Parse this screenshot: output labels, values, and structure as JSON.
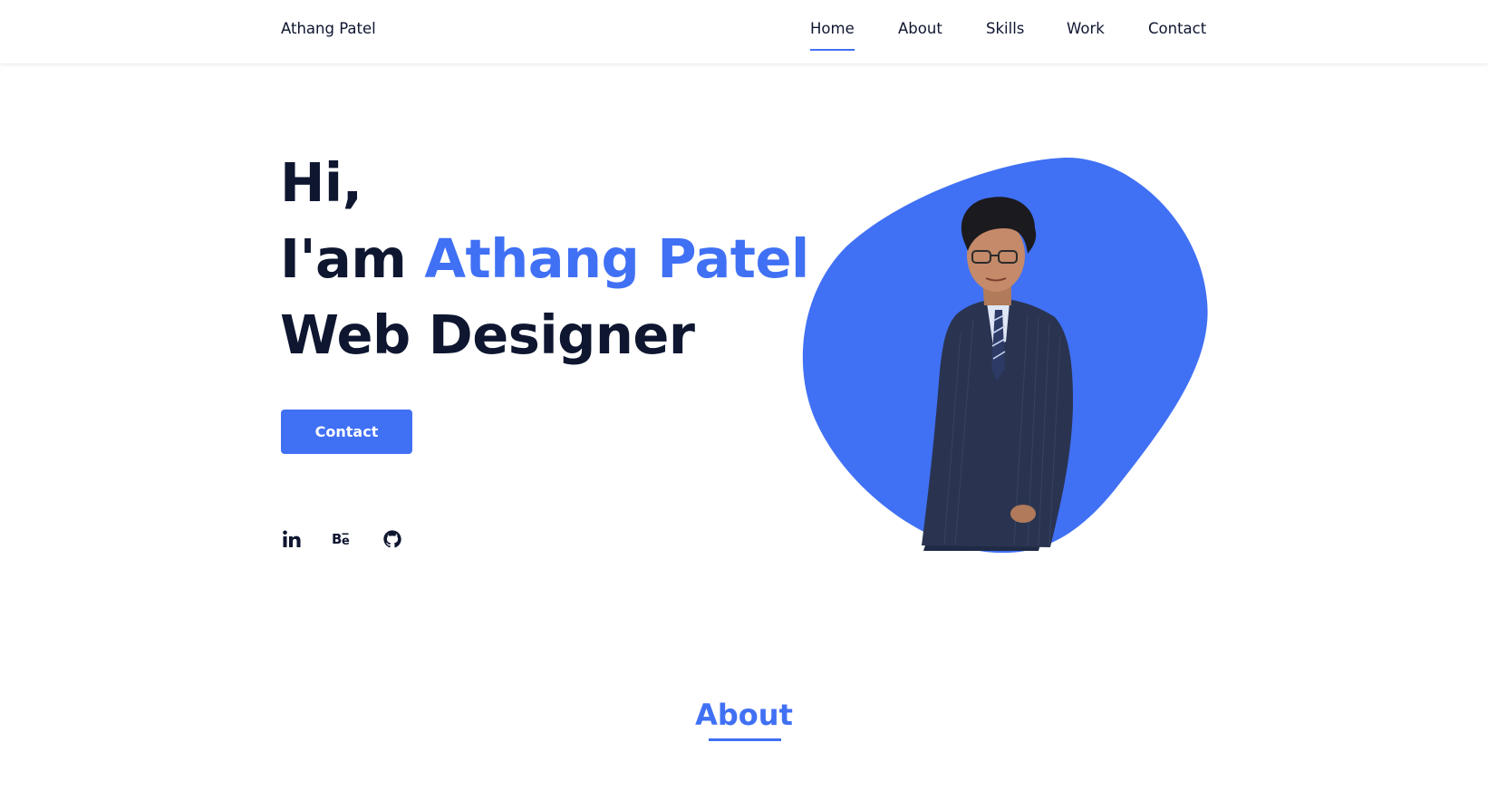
{
  "colors": {
    "accent": "#4070f4",
    "text_dark": "#0e1630",
    "background": "#ffffff"
  },
  "header": {
    "logo": "Athang Patel",
    "nav": [
      {
        "label": "Home",
        "active": true
      },
      {
        "label": "About",
        "active": false
      },
      {
        "label": "Skills",
        "active": false
      },
      {
        "label": "Work",
        "active": false
      },
      {
        "label": "Contact",
        "active": false
      }
    ]
  },
  "hero": {
    "line1": "Hi,",
    "line2_prefix": "I'am ",
    "line2_name": "Athang Patel",
    "line3": "Web Designer",
    "button_label": "Contact",
    "social": [
      {
        "icon": "linkedin-icon",
        "text": "in"
      },
      {
        "icon": "behance-icon",
        "text": "Bē"
      },
      {
        "icon": "github-icon"
      }
    ],
    "image": {
      "description_icon": "profile-photo"
    }
  },
  "about": {
    "title": "About"
  }
}
